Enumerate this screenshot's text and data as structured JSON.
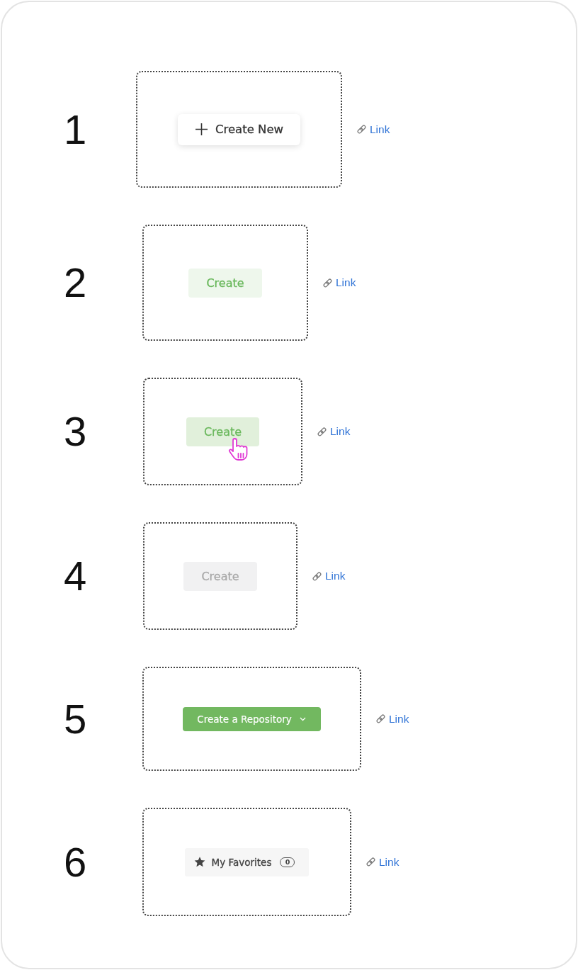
{
  "examples": [
    {
      "number": "1",
      "button": {
        "kind": "add",
        "label": "Create New",
        "hovered": false,
        "disabled": false
      },
      "link": "Link"
    },
    {
      "number": "2",
      "button": {
        "kind": "tinted",
        "label": "Create",
        "hovered": false,
        "disabled": false
      },
      "link": "Link"
    },
    {
      "number": "3",
      "button": {
        "kind": "tinted",
        "label": "Create",
        "hovered": true,
        "disabled": false
      },
      "link": "Link"
    },
    {
      "number": "4",
      "button": {
        "kind": "tinted",
        "label": "Create",
        "hovered": false,
        "disabled": true
      },
      "link": "Link"
    },
    {
      "number": "5",
      "button": {
        "kind": "dropdown",
        "label": "Create a Repository",
        "hovered": false,
        "disabled": false
      },
      "link": "Link"
    },
    {
      "number": "6",
      "button": {
        "kind": "counter",
        "label": "My Favorites",
        "count": "0",
        "hovered": false,
        "disabled": false
      },
      "link": "Link"
    }
  ]
}
